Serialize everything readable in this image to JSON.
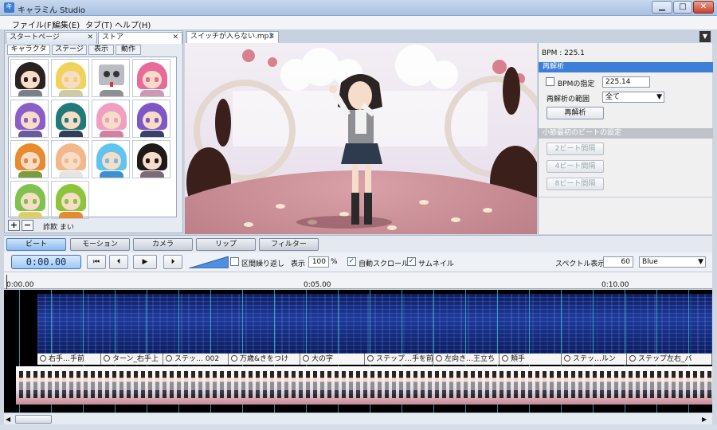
{
  "window": {
    "title": "キャラミん Studio",
    "app_icon": "app-icon",
    "controls": [
      "minimize-icon",
      "maximize-icon",
      "close-icon"
    ]
  },
  "menu": {
    "items": [
      "ファイル(F)",
      "編集(E)",
      "タブ(T)",
      "ヘルプ(H)"
    ]
  },
  "left_tabs": {
    "start_page": "スタートページ",
    "store": "ストア",
    "sub_tabs": [
      "キャラクター",
      "ステージ",
      "表示",
      "動作"
    ]
  },
  "characters": {
    "selected_name": "詐欺 まい",
    "add_label": "+",
    "remove_label": "−",
    "portraits": [
      {
        "hair": "#2a2220",
        "outfit": "#7a7f88"
      },
      {
        "hair": "#f0d35a",
        "outfit": "#d0c9a6"
      },
      {
        "hair": "#b9bcc2",
        "outfit": "#8e9096",
        "robot": true
      },
      {
        "hair": "#e66a9a",
        "outfit": "#c99ab3"
      },
      {
        "hair": "#8a5fc9",
        "outfit": "#6c5aa0"
      },
      {
        "hair": "#1f7a78",
        "outfit": "#2f3f55"
      },
      {
        "hair": "#ef9fc2",
        "outfit": "#d57ea6"
      },
      {
        "hair": "#7c57c5",
        "outfit": "#3b3f6b"
      },
      {
        "hair": "#e88a2e",
        "outfit": "#7a9c3c"
      },
      {
        "hair": "#f1b98b",
        "outfit": "#e4e4e4"
      },
      {
        "hair": "#5fc4ee",
        "outfit": "#3d8fd0"
      },
      {
        "hair": "#1e1a1a",
        "outfit": "#7e6a76"
      },
      {
        "hair": "#7fc24e",
        "outfit": "#dccf6a"
      },
      {
        "hair": "#8cc43a",
        "outfit": "#e58a2d"
      }
    ]
  },
  "document": {
    "tab_label": "スイッチが入らない.mp3",
    "dropdown_icon": "chevron-down-icon"
  },
  "right_panel": {
    "bpm_readout": "BPM : 225.1",
    "reanalyze_header": "再解析",
    "bpm_specify_label": "BPMの指定",
    "bpm_value": "225.14",
    "range_label": "再解析の範囲",
    "range_value": "全て",
    "reanalyze_button": "再解析",
    "first_beat_header": "小節最初のビートの設定",
    "beat_buttons": [
      "2ビート間隔",
      "4ビート間隔",
      "8ビート間隔"
    ]
  },
  "mode_tabs": [
    "ビート",
    "モーション",
    "カメラ",
    "リップ",
    "フィルター"
  ],
  "transport": {
    "timecode": "0:00.00",
    "buttons": [
      "skip-start-icon",
      "step-back-icon",
      "play-icon",
      "step-forward-icon"
    ],
    "loop_label": "区間繰り返し",
    "display_label": "表示",
    "zoom_value": "100",
    "zoom_unit": "%",
    "auto_scroll_label": "自動スクロール",
    "thumbnail_label": "サムネイル",
    "spectrum_label": "スペクトル表示",
    "spectrum_value": "60",
    "color_value": "Blue"
  },
  "ruler": {
    "ticks": [
      "0:00.00",
      "0:05.00",
      "0:10.00"
    ]
  },
  "timeline": {
    "motions": [
      "右手…手前",
      "ターン_右手上",
      "ステッ… 002",
      "万歳&きをつけ",
      "大の字",
      "ステップ…手を前",
      "左向き…王立ち",
      "頬手",
      "ステッ…ルン",
      "ステップ左右_バ"
    ]
  }
}
